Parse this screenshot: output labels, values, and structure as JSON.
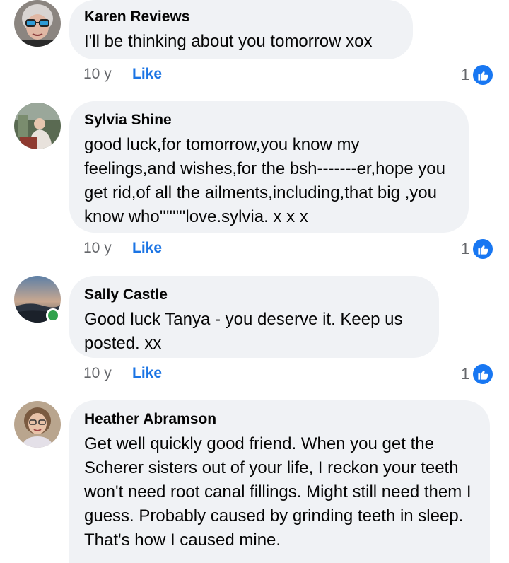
{
  "comments": [
    {
      "author": "Karen Reviews",
      "text": "I'll be thinking about you tomorrow xox",
      "time": "10 y",
      "like_label": "Like",
      "reaction_count": "1",
      "online": false
    },
    {
      "author": "Sylvia Shine",
      "text": "good luck,for tomorrow,you know my feelings,and wishes,for the bsh-------er,hope you get rid,of all the ailments,including,that big ,you know who''''''''love.sylvia. x x x",
      "time": "10 y",
      "like_label": "Like",
      "reaction_count": "1",
      "online": false
    },
    {
      "author": "Sally Castle",
      "text": "Good luck Tanya - you deserve it. Keep us posted. xx",
      "time": "10 y",
      "like_label": "Like",
      "reaction_count": "1",
      "online": true
    },
    {
      "author": "Heather Abramson",
      "text": "Get well quickly good friend. When you get the Scherer sisters out of your life, I reckon your teeth won't need root canal fillings. Might still need them I guess. Probably caused by grinding teeth in sleep. That's how I caused mine.",
      "online": false
    }
  ],
  "colors": {
    "bubble": "#f0f2f5",
    "like_link": "#1b74e4",
    "meta_text": "#65676b",
    "reaction_badge": "#1877f2",
    "online_dot": "#31a24c"
  },
  "icons": {
    "reaction": "thumbs-up-icon",
    "presence": "online-status-dot"
  }
}
